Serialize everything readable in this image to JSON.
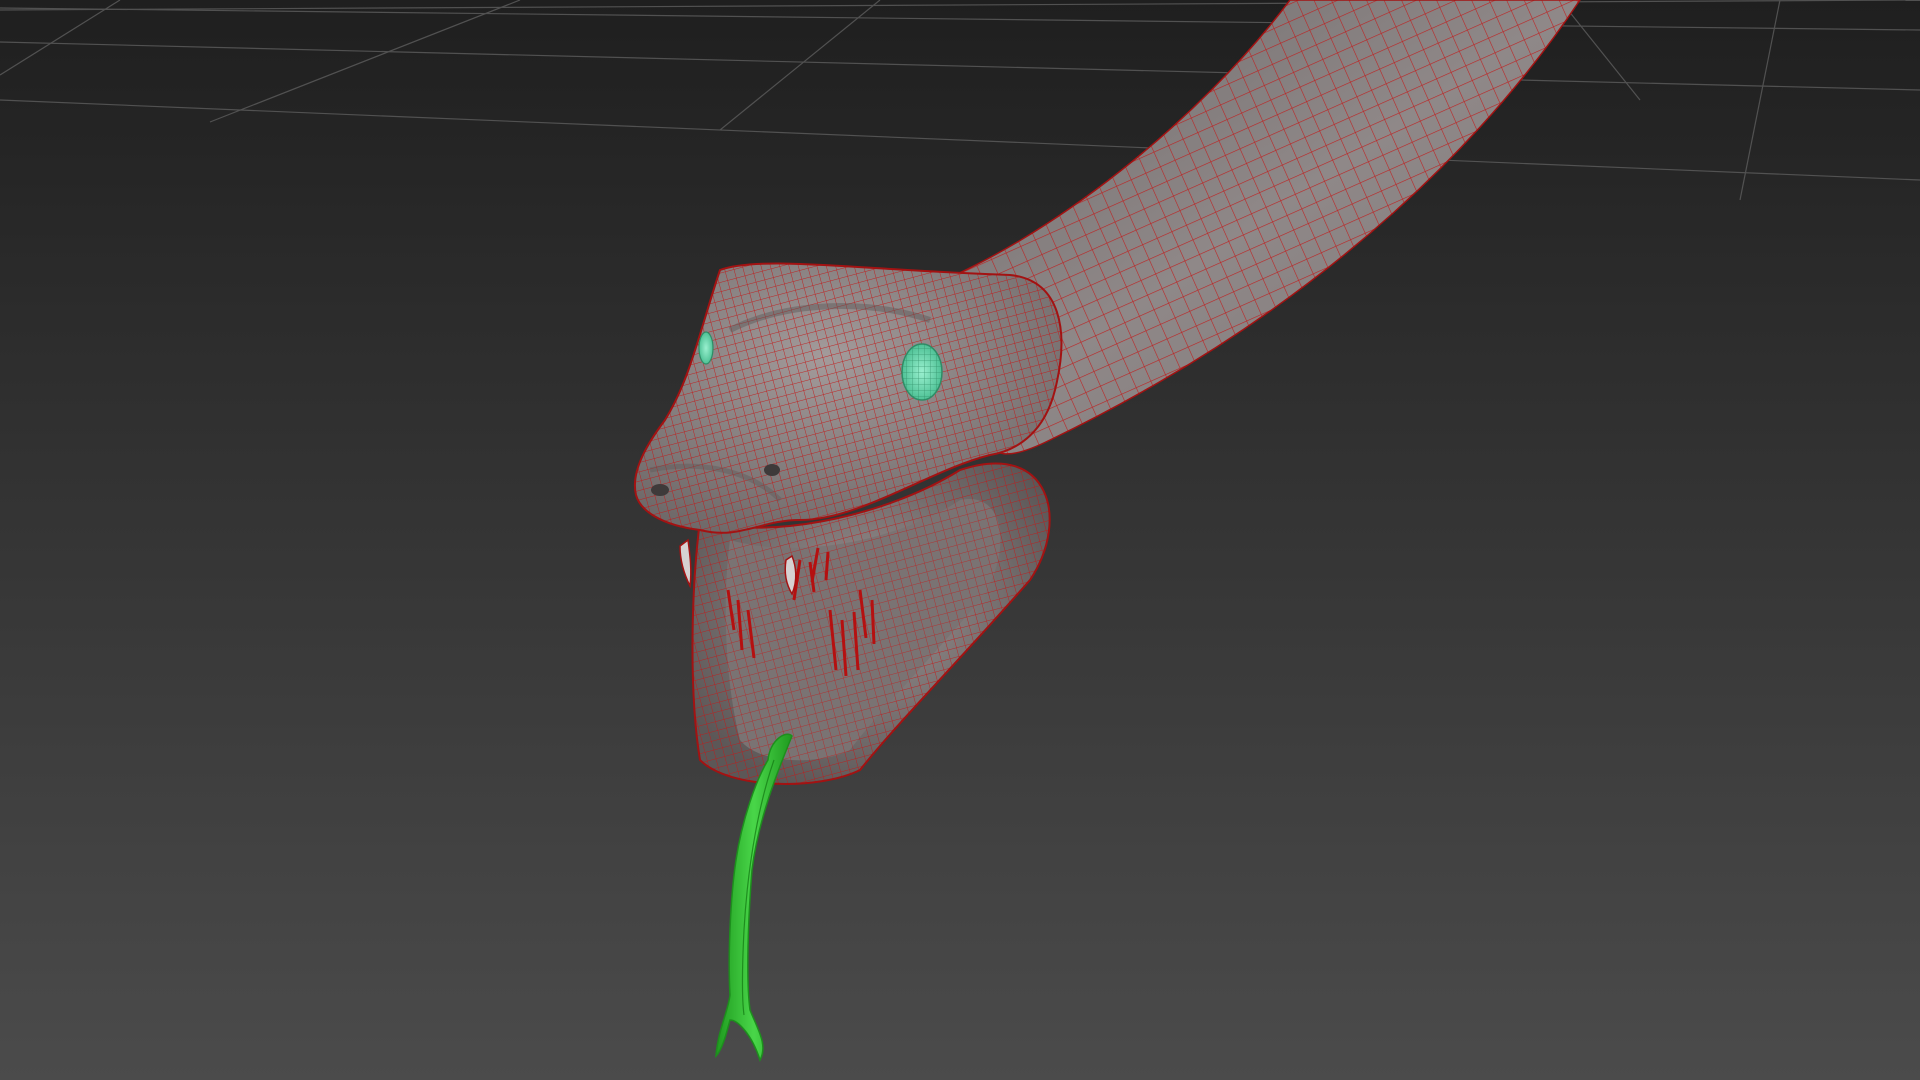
{
  "viewport": {
    "background_top": "#1f1f1f",
    "background_bottom": "#4b4b4b",
    "grid_color": "#5a5a5a"
  },
  "model": {
    "body_color": "#8a8585",
    "wire_color": "#c11a1a",
    "eye_color": "#69e6b6",
    "tongue_color": "#2fbf2f",
    "tongue_wire": "#1d8f1d"
  }
}
